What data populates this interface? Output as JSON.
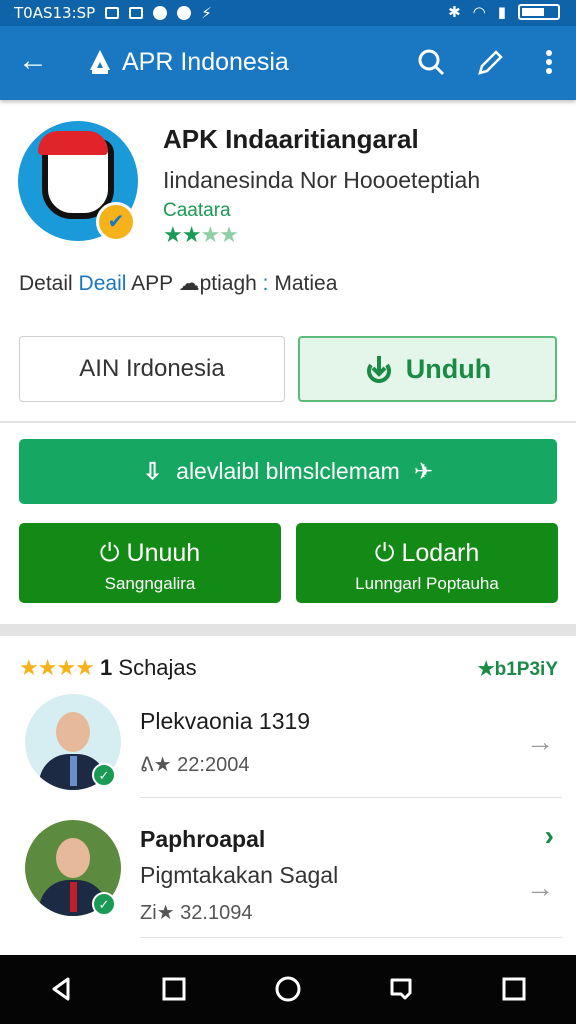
{
  "status_bar": {
    "carrier": "T0AS13:SP",
    "icons": [
      "image-icon",
      "note-icon",
      "circle-icon",
      "chat-icon",
      "flash-icon",
      "bluetooth-icon",
      "wifi-icon",
      "signal-icon",
      "battery-icon"
    ]
  },
  "app_bar": {
    "title": "APR Indonesia",
    "icons": [
      "back-arrow-icon",
      "app-logo-icon",
      "search-icon",
      "edit-icon",
      "more-vert-icon"
    ]
  },
  "app": {
    "name": "APK Indaaritiangaral",
    "subtitle": "Iindanesinda Nor Hoooeteptiah",
    "developer": "Caatara",
    "rating_stars": "★★★★",
    "colors": {
      "accent": "#1a78c2",
      "green": "#16a862",
      "dark_green": "#148a16",
      "star": "#1a9a55"
    }
  },
  "detail_row": {
    "detail": "Detail",
    "deail": "Deail",
    "app": "APP",
    "ptiagh": "ptiagh",
    "sep": ":",
    "matiea": "Matiea"
  },
  "buttons": {
    "outline": "AIN Irdonesia",
    "unduh_top": "Unduh",
    "wide": "alevlaibl blmslclemam",
    "left_label": "Unuuh",
    "left_sub": "Sangngalira",
    "right_label": "Lodarh",
    "right_sub": "Lunngarl Poptauha"
  },
  "reviews": {
    "stars": "★★★★",
    "count_prefix": "1",
    "title": "Schajas",
    "code": "★b1P3iY",
    "items": [
      {
        "name": "Plekvaonia 1319",
        "meta": "ᕕ★ 22:2004"
      },
      {
        "name": "Paphroapal",
        "meta2": "Pigmtakakan Sagal",
        "meta": "Zi★ 32.1094"
      }
    ]
  },
  "nav_bar": {
    "icons": [
      "back-triangle-icon",
      "recents-square-icon",
      "home-circle-icon",
      "assist-icon",
      "overview-square-icon"
    ]
  }
}
